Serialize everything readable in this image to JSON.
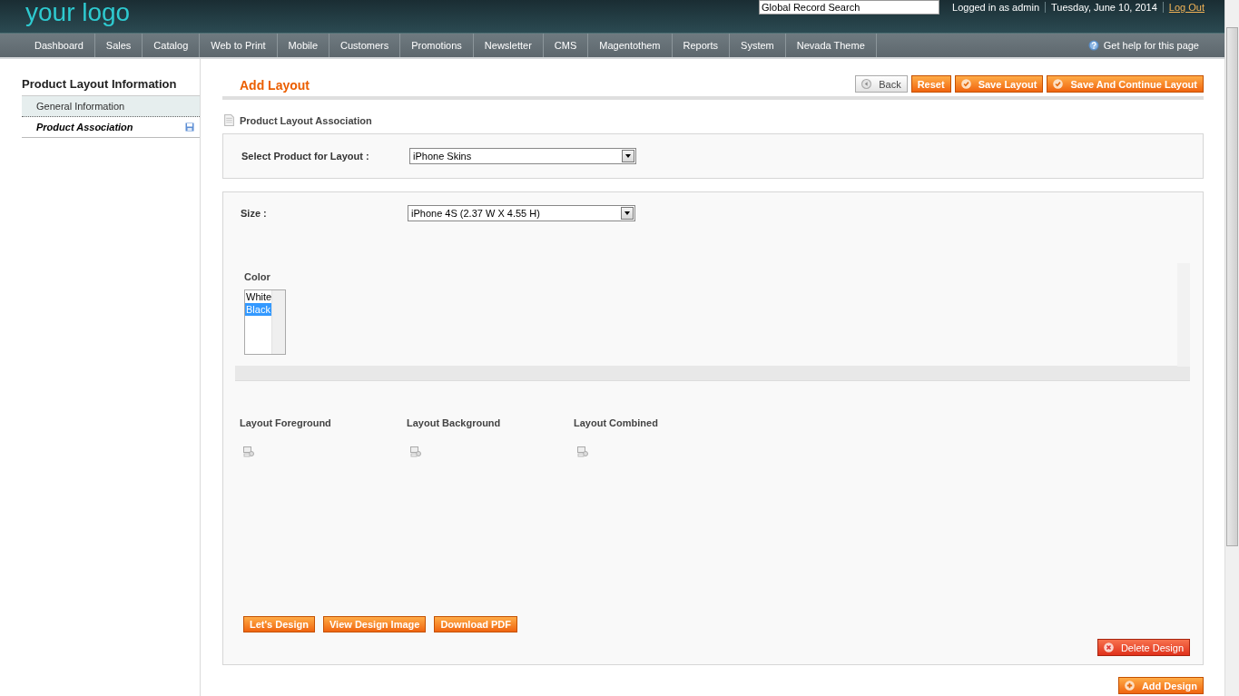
{
  "header": {
    "logo": "your logo",
    "search": {
      "value": "Global Record Search"
    },
    "user": "Logged in as admin",
    "date": "Tuesday, June 10, 2014",
    "logout": "Log Out"
  },
  "nav": {
    "items": [
      "Dashboard",
      "Sales",
      "Catalog",
      "Web to Print",
      "Mobile",
      "Customers",
      "Promotions",
      "Newsletter",
      "CMS",
      "Magentothem",
      "Reports",
      "System",
      "Nevada Theme"
    ],
    "help": "Get help for this page"
  },
  "sidebar": {
    "title": "Product Layout Information",
    "tabs": [
      {
        "label": "General Information",
        "selected": false,
        "changed": false
      },
      {
        "label": "Product Association",
        "selected": true,
        "changed": true
      }
    ]
  },
  "page": {
    "title": "Add Layout",
    "buttons": [
      {
        "label": "Back",
        "kind": "back"
      },
      {
        "label": "Reset",
        "kind": "plain"
      },
      {
        "label": "Save Layout",
        "kind": "save"
      },
      {
        "label": "Save And Continue Layout",
        "kind": "save"
      }
    ]
  },
  "section": {
    "title": "Product Layout Association",
    "product": {
      "label": "Select Product for Layout :",
      "value": "iPhone Skins"
    }
  },
  "design": {
    "size": {
      "label": "Size :",
      "value": "iPhone 4S (2.37 W X 4.55 H)"
    },
    "color": {
      "label": "Color",
      "options": [
        {
          "label": "White",
          "selected": false
        },
        {
          "label": "Black",
          "selected": true
        }
      ]
    },
    "images": [
      "Layout Foreground",
      "Layout Background",
      "Layout Combined"
    ],
    "buttons": [
      "Let's Design",
      "View Design Image",
      "Download PDF"
    ],
    "delete": "Delete Design"
  },
  "add": "Add Design"
}
